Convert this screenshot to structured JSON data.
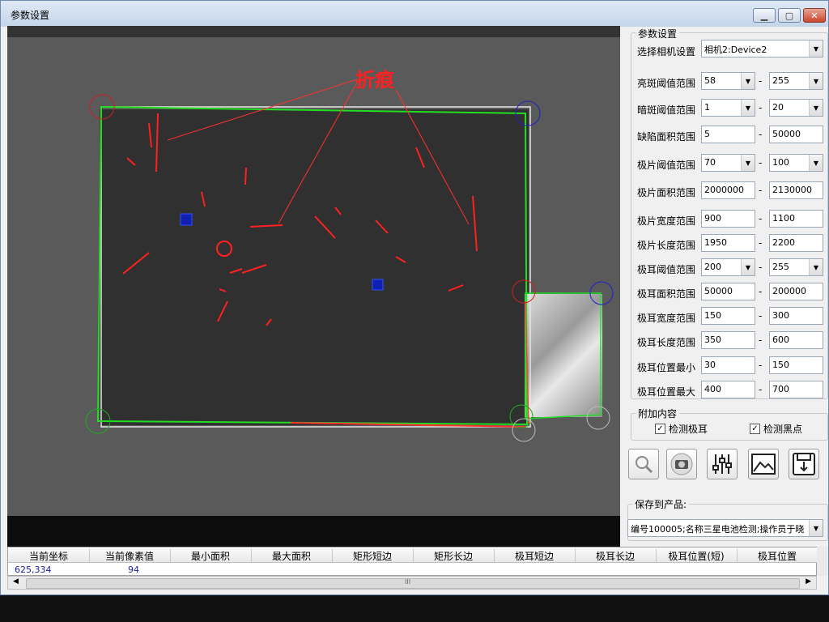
{
  "window": {
    "title": "参数设置"
  },
  "viewer": {
    "annotation": "折痕"
  },
  "params": {
    "group_title": "参数设置",
    "camera_label": "选择相机设置",
    "camera_value": "相机2:Device2",
    "rows": [
      {
        "label": "亮斑阈值范围",
        "min": "58",
        "max": "255",
        "type": "combo"
      },
      {
        "label": "暗斑阈值范围",
        "min": "1",
        "max": "20",
        "type": "combo"
      },
      {
        "label": "缺陷面积范围",
        "min": "5",
        "max": "50000",
        "type": "text"
      },
      {
        "label": "极片阈值范围",
        "min": "70",
        "max": "100",
        "type": "combo"
      },
      {
        "label": "极片面积范围",
        "min": "2000000",
        "max": "2130000",
        "type": "text"
      },
      {
        "label": "极片宽度范围",
        "min": "900",
        "max": "1100",
        "type": "text"
      },
      {
        "label": "极片长度范围",
        "min": "1950",
        "max": "2200",
        "type": "text"
      },
      {
        "label": "极耳阈值范围",
        "min": "200",
        "max": "255",
        "type": "combo"
      },
      {
        "label": "极耳面积范围",
        "min": "50000",
        "max": "200000",
        "type": "text"
      },
      {
        "label": "极耳宽度范围",
        "min": "150",
        "max": "300",
        "type": "text"
      },
      {
        "label": "极耳长度范围",
        "min": "350",
        "max": "600",
        "type": "text"
      },
      {
        "label": "极耳位置最小",
        "min": "30",
        "max": "150",
        "type": "text"
      },
      {
        "label": "极耳位置最大",
        "min": "400",
        "max": "700",
        "type": "text"
      }
    ],
    "dash": "-"
  },
  "extra": {
    "group_title": "附加内容",
    "detect_tab": "检测极耳",
    "detect_black": "检测黑点",
    "check_mark": "✓"
  },
  "toolbar": [
    "magnifier-icon",
    "camera-icon",
    "sliders-icon",
    "image-icon",
    "save-icon"
  ],
  "save": {
    "group_title": "保存到产品:",
    "value": "编号100005;名称三星电池检测;操作员于晓"
  },
  "grid": {
    "headers": [
      "当前坐标",
      "当前像素值",
      "最小面积",
      "最大面积",
      "矩形短边",
      "矩形长边",
      "极耳短边",
      "极耳长边",
      "极耳位置(短)",
      "极耳位置"
    ],
    "row": [
      "625,334",
      "94"
    ],
    "scroll_mark": "III"
  }
}
